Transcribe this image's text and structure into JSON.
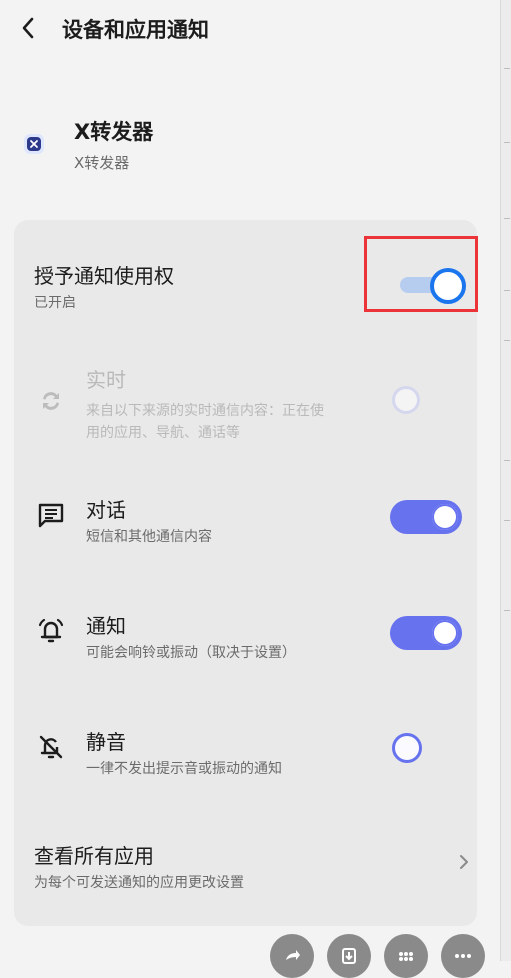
{
  "header": {
    "title": "设备和应用通知"
  },
  "app": {
    "name": "X转发器",
    "subtitle": "X转发器"
  },
  "settings": {
    "master": {
      "title": "授予通知使用权",
      "subtitle": "已开启",
      "enabled": true
    },
    "items": [
      {
        "title": "实时",
        "subtitle_line1": "来自以下来源的实时通信内容：正在使",
        "subtitle_line2": "用的应用、导航、通话等",
        "icon": "sync-icon",
        "state": "disabled"
      },
      {
        "title": "对话",
        "subtitle": "短信和其他通信内容",
        "icon": "chat-icon",
        "state": "on"
      },
      {
        "title": "通知",
        "subtitle": "可能会响铃或振动（取决于设置）",
        "icon": "bell-ringing-icon",
        "state": "on"
      },
      {
        "title": "静音",
        "subtitle": "一律不发出提示音或振动的通知",
        "icon": "bell-off-icon",
        "state": "radio"
      }
    ],
    "all_apps": {
      "title": "查看所有应用",
      "subtitle": "为每个可发送通知的应用更改设置"
    }
  },
  "colors": {
    "accent": "#6772ef",
    "master_thumb": "#1b76ee",
    "highlight": "#ec3438"
  }
}
